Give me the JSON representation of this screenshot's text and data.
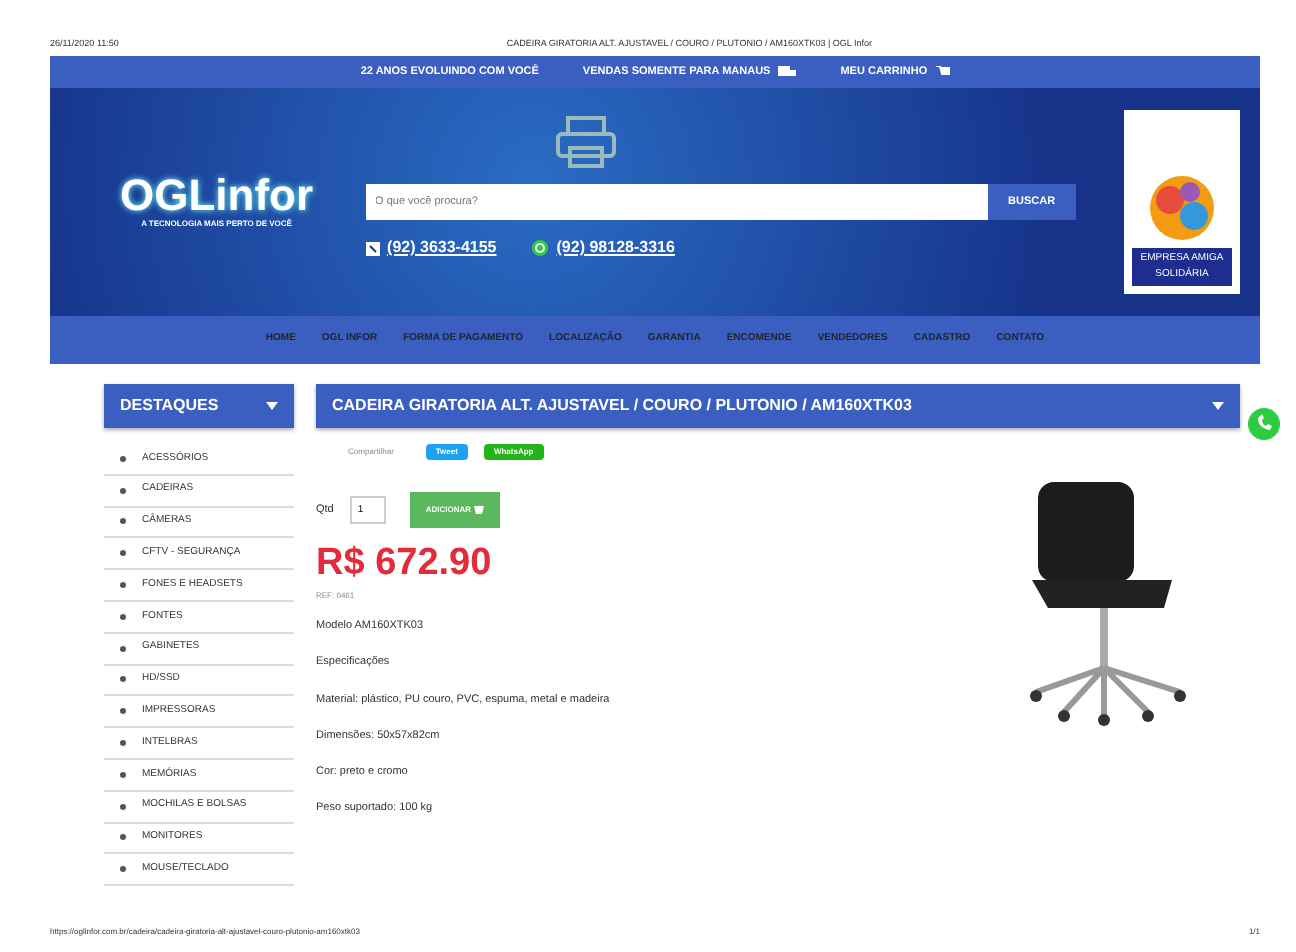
{
  "print_header": {
    "date": "26/11/2020 11:50",
    "title": "CADEIRA GIRATORIA ALT. AJUSTAVEL / COURO / PLUTONIO / AM160XTK03 | OGL Infor"
  },
  "top_bar": {
    "slogan": "22 ANOS EVOLUINDO COM VOCÊ",
    "delivery": "VENDAS SOMENTE PARA MANAUS",
    "cart_link": "MEU CARRINHO"
  },
  "banner": {
    "logo": "OGLinfor",
    "tagline": "A TECNOLOGIA MAIS PERTO DE VOCÊ",
    "search": {
      "placeholder": "O que você procura?",
      "button": "BUSCAR"
    },
    "phone": "(92) 3633-4155",
    "whatsapp": "(92) 98128-3316",
    "badge": "EMPRESA AMIGA SOLIDÁRIA"
  },
  "nav": [
    "HOME",
    "OGL INFOR",
    "FORMA DE PAGAMENTO",
    "LOCALIZAÇÃO",
    "GARANTIA",
    "ENCOMENDE",
    "VENDEDORES",
    "CADASTRO",
    "CONTATO"
  ],
  "sidebar": {
    "title": "DESTAQUES",
    "items": [
      "ACESSÓRIOS",
      "CADEIRAS",
      "CÂMERAS",
      "CFTV - SEGURANÇA",
      "FONES E HEADSETS",
      "FONTES",
      "GABINETES",
      "HD/SSD",
      "IMPRESSORAS",
      "INTELBRAS",
      "MEMÓRIAS",
      "MOCHILAS E BOLSAS",
      "MONITORES",
      "MOUSE/TECLADO"
    ]
  },
  "product": {
    "title": "CADEIRA GIRATORIA ALT. AJUSTAVEL / COURO / PLUTONIO / AM160XTK03",
    "share_label": "Compartilhar",
    "share_buttons": [
      {
        "kind": "tweet",
        "label": "Tweet"
      },
      {
        "kind": "whatsapp",
        "label": "WhatsApp"
      }
    ],
    "qty_label": "Qtd",
    "qty": "1",
    "add_button": "ADICIONAR",
    "price": "R$ 672.90",
    "ref": "REF: 0461",
    "details": [
      "Modelo AM160XTK03",
      "Especificações",
      "Material: plástico, PU couro, PVC, espuma, metal e madeira",
      "Dimensões: 50x57x82cm",
      "Cor: preto e cromo",
      "Peso suportado: 100 kg"
    ]
  },
  "print_footer": {
    "url": "https://oglinfor.com.br/cadeira/cadeira-giratoria-alt-ajustavel-couro-plutonio-am160xtk03",
    "page": "1/1"
  }
}
